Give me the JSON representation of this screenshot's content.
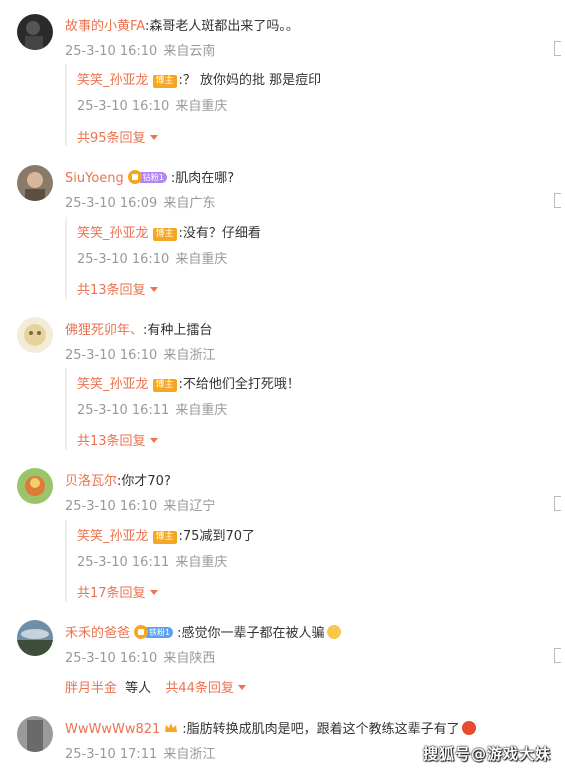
{
  "comments": [
    {
      "username": "故事的小黄FA",
      "text": ":森哥老人斑都出来了吗。。",
      "date": "25-3-10 16:10",
      "location": "来自云南",
      "reply": {
        "username": "笑笑_孙亚龙",
        "badge": "博主",
        "text": ":？ 放你妈的批 那是痘印",
        "date": "25-3-10 16:10",
        "location": "来自重庆"
      },
      "reply_count": "共95条回复"
    },
    {
      "username": "SiuYoeng",
      "fan_badge": "钻粉1",
      "text": ":肌肉在哪?",
      "date": "25-3-10 16:09",
      "location": "来自广东",
      "reply": {
        "username": "笑笑_孙亚龙",
        "badge": "博主",
        "text": ":没有？仔细看",
        "date": "25-3-10 16:10",
        "location": "来自重庆"
      },
      "reply_count": "共13条回复"
    },
    {
      "username": "佛狸死卯年、",
      "text": ":有种上擂台",
      "date": "25-3-10 16:10",
      "location": "来自浙江",
      "reply": {
        "username": "笑笑_孙亚龙",
        "badge": "博主",
        "text": ":不给他们全打死哦！",
        "date": "25-3-10 16:11",
        "location": "来自重庆"
      },
      "reply_count": "共13条回复"
    },
    {
      "username": "贝洛瓦尔",
      "text": ":你才70?",
      "date": "25-3-10 16:10",
      "location": "来自辽宁",
      "reply": {
        "username": "笑笑_孙亚龙",
        "badge": "博主",
        "text": ":75减到70了",
        "date": "25-3-10 16:11",
        "location": "来自重庆"
      },
      "reply_count": "共17条回复"
    },
    {
      "username": "禾禾的爸爸",
      "fan_badge": "铁粉1",
      "text": ":感觉你一辈子都在被人骗",
      "date": "25-3-10 16:10",
      "location": "来自陕西",
      "sub_user": "胖月半金",
      "sub_others": "等人",
      "reply_count": "共44条回复"
    },
    {
      "username": "WwWwWw821",
      "text": ":脂肪转换成肌肉是吧，跟着这个教练这辈子有了",
      "date": "25-3-10 17:11",
      "location": "来自浙江"
    }
  ],
  "watermark": "搜狐号@游戏大妹",
  "colors": {
    "accent": "#eb7350",
    "meta": "#999999",
    "badge": "#f5a623"
  }
}
